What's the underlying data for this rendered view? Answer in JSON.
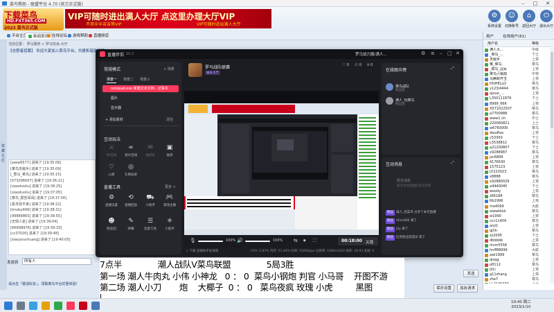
{
  "host": {
    "title": "菜鸟帮助 - 联盟平台 4.70 (官方正式版)",
    "logo_line1": "下载菜鸟",
    "logo_line2": "HD.FXT365.COM",
    "logo_line3": "2023 菜鸟正式版",
    "ad_main": "VIP可随时进出满人大厅   点这里办理大厅VIP",
    "ad_sub1": "不用辛辛苦苦等VIP",
    "ad_sub2": "VIP可随时进出满人大厅",
    "top_icons": [
      {
        "label": "系统设置",
        "glyph": "⚙"
      },
      {
        "label": "切换账号",
        "glyph": "☺"
      },
      {
        "label": "返回大厅",
        "glyph": "⌂"
      },
      {
        "label": "退出大厅",
        "glyph": "⏻"
      }
    ],
    "nav_tabs": [
      {
        "label": "平台主页",
        "color": "#3b7bd6"
      },
      {
        "label": "新闻资讯",
        "color": "#2fa84f"
      },
      {
        "label": "在线论坛",
        "color": "#e08a1e"
      },
      {
        "label": "游戏帮助",
        "color": "#3b7bd6"
      },
      {
        "label": "直播频道",
        "color": "#d63b3b"
      }
    ],
    "path": "当前位置：  罗马服务 >   罗马协会-大厅",
    "notice": "【志愿者招募】  欢迎大家加入菜鸟平台，共建和谐游戏环境，一起参与！",
    "left_strip_label": "隐藏左栏",
    "log_items": [
      "[www6577] 进来了 [19:35:06]",
      "[菜鸟无敌手] 进来了 [19:35:09]",
      "[_惹马_菜鸟] 进来了 [19:35:15]",
      "[573296007] 进来了 [19:36:21]",
      "[xiaoduoliu] 进来了 [19:36:25]",
      "[xiaoduoliu] 进来了 [19:37:05]",
      "[菜鸟_报告哥哥] 进来了 [19:37:34]",
      "[看寻找不来] 进来了 [19:38:22]",
      "[tmdsy999] 进来了 [19:38:31]",
      "[99889865] 进来了 [19:38:55]",
      "[无情人走] 进来了 [19:39:04]",
      "[RK698976] 进来了 [19:39:33]",
      "[cc37020] 进来了 [19:39:48]",
      "[xiaoyouchuang] 进来了 [19:40:05]"
    ],
    "send_label": "发送到",
    "send_target": "所有人",
    "bottom_link": "请点击『邀请好友』，领取菜鸟平台优惠体验！",
    "btn_fav": "保存设置",
    "btn_send": "加友请求",
    "btn_send_small": "发送"
  },
  "right_panel": {
    "tab_users": "用户",
    "tab_online": "在线用户(81)",
    "head_name": "用户名",
    "head_level": "等级",
    "users": [
      {
        "name": "满人大...",
        "level": "中级"
      },
      {
        "name": "_菜鸟_...",
        "level": "下士"
      },
      {
        "name": "无敌手",
        "level": "上将"
      },
      {
        "name": "嘟_菜鸟",
        "level": "菜鸟"
      },
      {
        "name": "_菜鸟_冠军",
        "level": "上将"
      },
      {
        "name": "菜鸟小钢炮",
        "level": "中将"
      },
      {
        "name": "马腾蛟开玉",
        "level": "上将"
      },
      {
        "name": "HOHELLO",
        "level": "菜鸟"
      },
      {
        "name": "v123/4444",
        "level": "菜鸟"
      },
      {
        "name": "ajxue_...",
        "level": "上将"
      },
      {
        "name": "L350111876",
        "level": "下士"
      },
      {
        "name": "8999_666",
        "level": "上将"
      },
      {
        "name": "X571022507",
        "level": "菜鸟"
      },
      {
        "name": "a7700988",
        "level": "菜鸟"
      },
      {
        "name": "www1.ch",
        "level": "中士"
      },
      {
        "name": "220060821",
        "level": "上士"
      },
      {
        "name": "w6783009",
        "level": "菜鸟"
      },
      {
        "name": "dasdfaa",
        "level": "上将"
      },
      {
        "name": "c53300",
        "level": "下士"
      },
      {
        "name": "L3536812",
        "level": "菜鸟"
      },
      {
        "name": "a21200807",
        "level": "下士"
      },
      {
        "name": "x9288987",
        "level": "菜鸟"
      },
      {
        "name": "jzc6899",
        "level": "上将"
      },
      {
        "name": "4176630",
        "level": "菜鸟"
      },
      {
        "name": "1575123",
        "level": "上将"
      },
      {
        "name": "LY223023",
        "level": "菜鸟"
      },
      {
        "name": "x8888",
        "level": "菜鸟"
      },
      {
        "name": "x92880029",
        "level": "上将"
      },
      {
        "name": "a4440045",
        "level": "下士"
      },
      {
        "name": "woody",
        "level": "上将"
      },
      {
        "name": "z66188",
        "level": "菜鸟"
      },
      {
        "name": "Rb1996",
        "level": "上将"
      },
      {
        "name": "mo4099",
        "level": "大航"
      },
      {
        "name": "wwwkkkk",
        "level": "菜鸟"
      },
      {
        "name": "w1990",
        "level": "上将"
      },
      {
        "name": "ccc11409",
        "level": "菜鸟"
      },
      {
        "name": "anji1",
        "level": "上将"
      },
      {
        "name": "qjhh",
        "level": "菜鸟"
      },
      {
        "name": "zz2005",
        "level": "下士"
      },
      {
        "name": "dbbbbb",
        "level": "上将"
      },
      {
        "name": "nlvm5558",
        "level": "菜鸟"
      },
      {
        "name": "hnff88999",
        "level": "大航"
      },
      {
        "name": "awl1999",
        "level": "菜鸟"
      },
      {
        "name": "qlsqg",
        "level": "上将"
      },
      {
        "name": "p8112",
        "level": "菜鸟"
      },
      {
        "name": "ljl1i",
        "level": "上将"
      },
      {
        "name": "g11zhang",
        "level": "上将"
      },
      {
        "name": "zha7",
        "level": "菜鸟"
      },
      {
        "name": "LL2145430",
        "level": "上士"
      }
    ]
  },
  "studio": {
    "app_name": "直播伴侣",
    "version": "10.2",
    "user": "罗马战力服/满人...",
    "mode_title": "常规模式",
    "add_label": "+ 场景",
    "scene_tabs": [
      "场景一",
      "场景二",
      "场景三"
    ],
    "sources": [
      {
        "label": "notepad.exe 新建文本文档 - 记事本",
        "selected": true
      },
      {
        "label": "图片",
        "selected": false
      },
      {
        "label": "显示器",
        "selected": false
      }
    ],
    "add_source": "+ 添加素材",
    "clear": "清空",
    "interact_title": "互动玩法",
    "interact_tools": [
      {
        "name": "PK连线",
        "glyph": "⚔",
        "dim": true
      },
      {
        "name": "观众连线",
        "glyph": "∞",
        "dim": false
      },
      {
        "name": "福袋玩",
        "glyph": "✉",
        "dim": true
      },
      {
        "name": "福袋",
        "glyph": "▣",
        "dim": false
      },
      {
        "name": "心愿",
        "glyph": "♡",
        "dim": false
      },
      {
        "name": "礼物投屏",
        "glyph": "◎",
        "dim": false
      }
    ],
    "live_tools_title": "直播工具",
    "live_tools_more": "更多 >",
    "live_tools": [
      {
        "name": "直播设置",
        "glyph": "⚙"
      },
      {
        "name": "直播回放",
        "glyph": "⟲"
      },
      {
        "name": "小程序",
        "glyph": "⛟"
      },
      {
        "name": "游戏主播",
        "glyph": "🎮"
      },
      {
        "name": "粉丝团",
        "glyph": "☻"
      },
      {
        "name": "弹幕",
        "glyph": "✎"
      },
      {
        "name": "连麦工具",
        "glyph": "☰"
      },
      {
        "name": "小助手",
        "glyph": "✳"
      }
    ],
    "room_title": "罗马战队联赛",
    "room_tag": "娱乐大厅",
    "stats": [
      "♡ 0",
      "⚇ 0",
      "⌾ 0"
    ],
    "ctrl_mic": "100%",
    "ctrl_vol": "100%",
    "ctrl_time": "00:18:00",
    "ctrl_end": "关播",
    "status": "CPU: 2.87%   内存: 51.46%   码率: 1500kbps   分辨率: 1080x1920   帧率: 29.93   丢帧: 0",
    "status_left": "⚠ 下载 直播助手极速版",
    "viewers_title": "在线观众榜",
    "viewers": [
      {
        "name": "菜鸟战队",
        "sub": "粉丝团",
        "color": "#6a8cc7"
      },
      {
        "name": "满人_玩菜鸟",
        "sub": "粉丝团",
        "color": "#9b9ea6"
      }
    ],
    "messages_title": "互动消息",
    "messages_hint": "暂无消息",
    "message_sub": "展示本场直播的互动消息",
    "messages": [
      {
        "badge": "粉丝",
        "text": "满人_玩菜鸟 分享了本次直播"
      },
      {
        "badge": "粉丝",
        "text": "Alice000  来了"
      },
      {
        "badge": "粉丝",
        "text": "jdy  来了"
      },
      {
        "badge": "粉丝",
        "text": "红色粉丝团成员  来了"
      }
    ]
  },
  "overlay": {
    "line1": "7点半              潮人战队V菜鸟联盟              5局3胜",
    "line2": "第一场 潮人牛肉丸 小伟 小神龙   0 ： 0  菜鸟小钢炮 判官 小马哥    开图不游",
    "line3": "第二场 潮人小刀       炮    大椰子  0 ： 0   菜鸟夜疯 玫瑰 小虎         黑图"
  },
  "taskbar": {
    "time": "19:40 周二",
    "date": "2023/1/10"
  }
}
